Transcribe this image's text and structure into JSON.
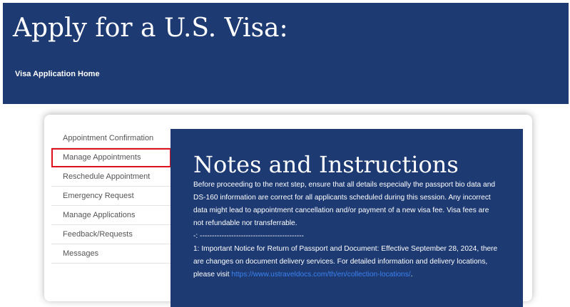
{
  "header": {
    "title": "Apply for a U.S. Visa:",
    "home_link": "Visa Application Home"
  },
  "sidebar": {
    "items": [
      {
        "label": "Appointment Confirmation"
      },
      {
        "label": "Manage Appointments"
      },
      {
        "label": "Reschedule Appointment"
      },
      {
        "label": "Emergency Request"
      },
      {
        "label": "Manage Applications"
      },
      {
        "label": "Feedback/Requests"
      },
      {
        "label": "Messages"
      }
    ],
    "highlighted_item": "Manage Appointments"
  },
  "notes": {
    "heading": "Notes and Instructions",
    "intro": "Before proceeding to the next step, ensure that all details especially the passport bio data and DS-160 information are correct for all applicants scheduled during this session. Any incorrect data might lead to appointment cancellation and/or payment of a new visa fee. Visa fees are not refundable nor transferrable.",
    "separator": "-: -------------------------------------------",
    "notice_text": "1: Important Notice for Return of Passport and Document: Effective September 28, 2024, there are changes on document delivery services. For detailed information and delivery locations, please visit ",
    "notice_link": "https://www.ustraveldocs.com/th/en/collection-locations/",
    "notice_end": "."
  },
  "colors": {
    "banner_bg": "#1d3a73",
    "panel_bg": "#1d3a73",
    "link": "#3b82f0",
    "highlight_border": "#e0101a"
  }
}
